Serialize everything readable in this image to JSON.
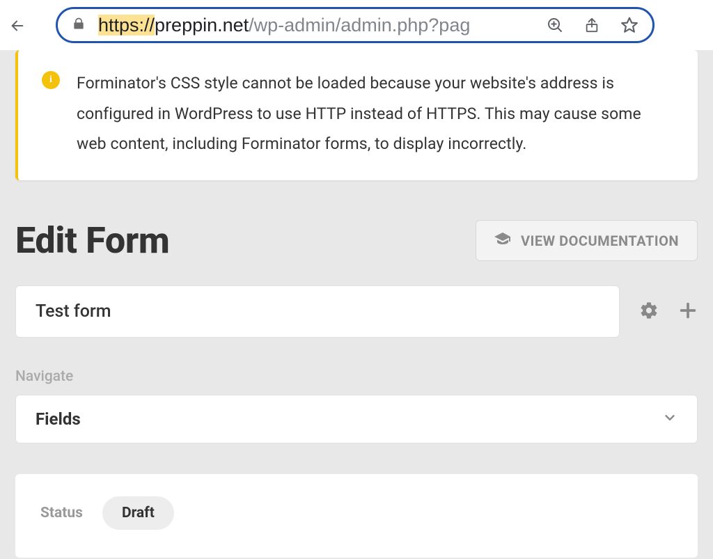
{
  "chrome": {
    "url_protocol": "https://",
    "url_domain": "preppin.net",
    "url_path": "/wp-admin/admin.php?pag"
  },
  "notice": {
    "text": "Forminator's CSS style cannot be loaded because your website's address is configured in WordPress to use HTTP instead of HTTPS. This may cause some web content, including Forminator forms, to display incorrectly."
  },
  "header": {
    "title": "Edit Form",
    "doc_button": "VIEW DOCUMENTATION"
  },
  "form": {
    "name": "Test form"
  },
  "nav": {
    "label": "Navigate",
    "selected": "Fields"
  },
  "status": {
    "label": "Status",
    "value": "Draft"
  }
}
